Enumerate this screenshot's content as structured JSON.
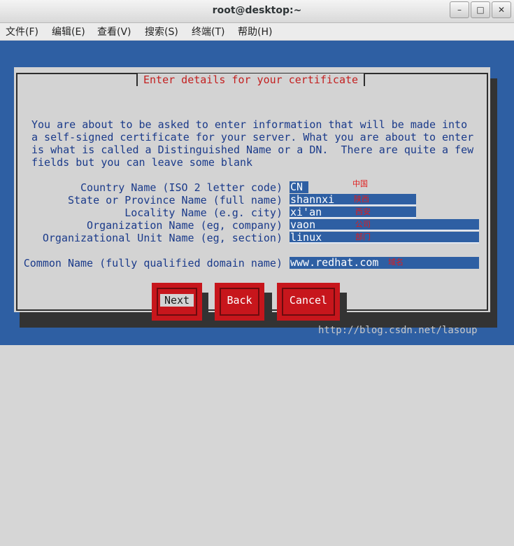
{
  "window": {
    "title": "root@desktop:~",
    "buttons": [
      "–",
      "□",
      "✕"
    ]
  },
  "menu": [
    "文件(F)",
    "编辑(E)",
    "查看(V)",
    "搜索(S)",
    "终端(T)",
    "帮助(H)"
  ],
  "dialog": {
    "title": "Enter details for your certificate",
    "paragraph": [
      "You are about to be asked to enter information that will be made into",
      "a self-signed certificate for your server. What you are about to enter",
      "is what is called a Distinguished Name or a DN.  There are quite a few",
      "fields but you can leave some blank"
    ],
    "fields": [
      {
        "label": "Country Name (ISO 2 letter code)",
        "value": "CN",
        "note": "中国"
      },
      {
        "label": "State or Province Name (full name)",
        "value": "shannxi",
        "note": "陕西"
      },
      {
        "label": "Locality Name (e.g. city)",
        "value": "xi'an",
        "note": "西安"
      },
      {
        "label": "Organization Name (eg, company)",
        "value": "vaon",
        "note": "公司"
      },
      {
        "label": "Organizational Unit Name (eg, section)",
        "value": "linux",
        "note": "部门"
      },
      {
        "label": "Common Name (fully qualified domain name)",
        "value": "www.redhat.com",
        "note": "域名"
      }
    ],
    "buttons": {
      "next": "Next",
      "back": "Back",
      "cancel": "Cancel"
    }
  },
  "watermark": "http://blog.csdn.net/lasoup",
  "colors": {
    "terminal_bg": "#2e5fa3",
    "dialog_bg": "#d3d3d3",
    "button_red": "#c7161c",
    "text_blue": "#1a3a8a",
    "annotation_red": "#e01b1b"
  }
}
